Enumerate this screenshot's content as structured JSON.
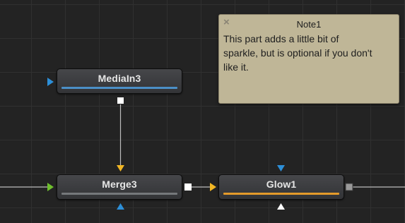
{
  "nodes": {
    "mediain": {
      "label": "MediaIn3"
    },
    "merge": {
      "label": "Merge3"
    },
    "glow": {
      "label": "Glow1"
    }
  },
  "note": {
    "title": "Note1",
    "close_icon": "×",
    "body": "This part adds a little bit of sparkle, but is optional if you don't like it."
  },
  "colors": {
    "canvas_bg": "#232323",
    "note_bg": "#bfb697",
    "mediain_bar": "#4b8fc7",
    "merge_bar": "#75787b",
    "glow_bar": "#e39a2a",
    "input_foreground": "#f1b624",
    "input_background": "#6fbf2e",
    "input_effect_mask": "#2d8fd8",
    "output": "#ffffff"
  }
}
